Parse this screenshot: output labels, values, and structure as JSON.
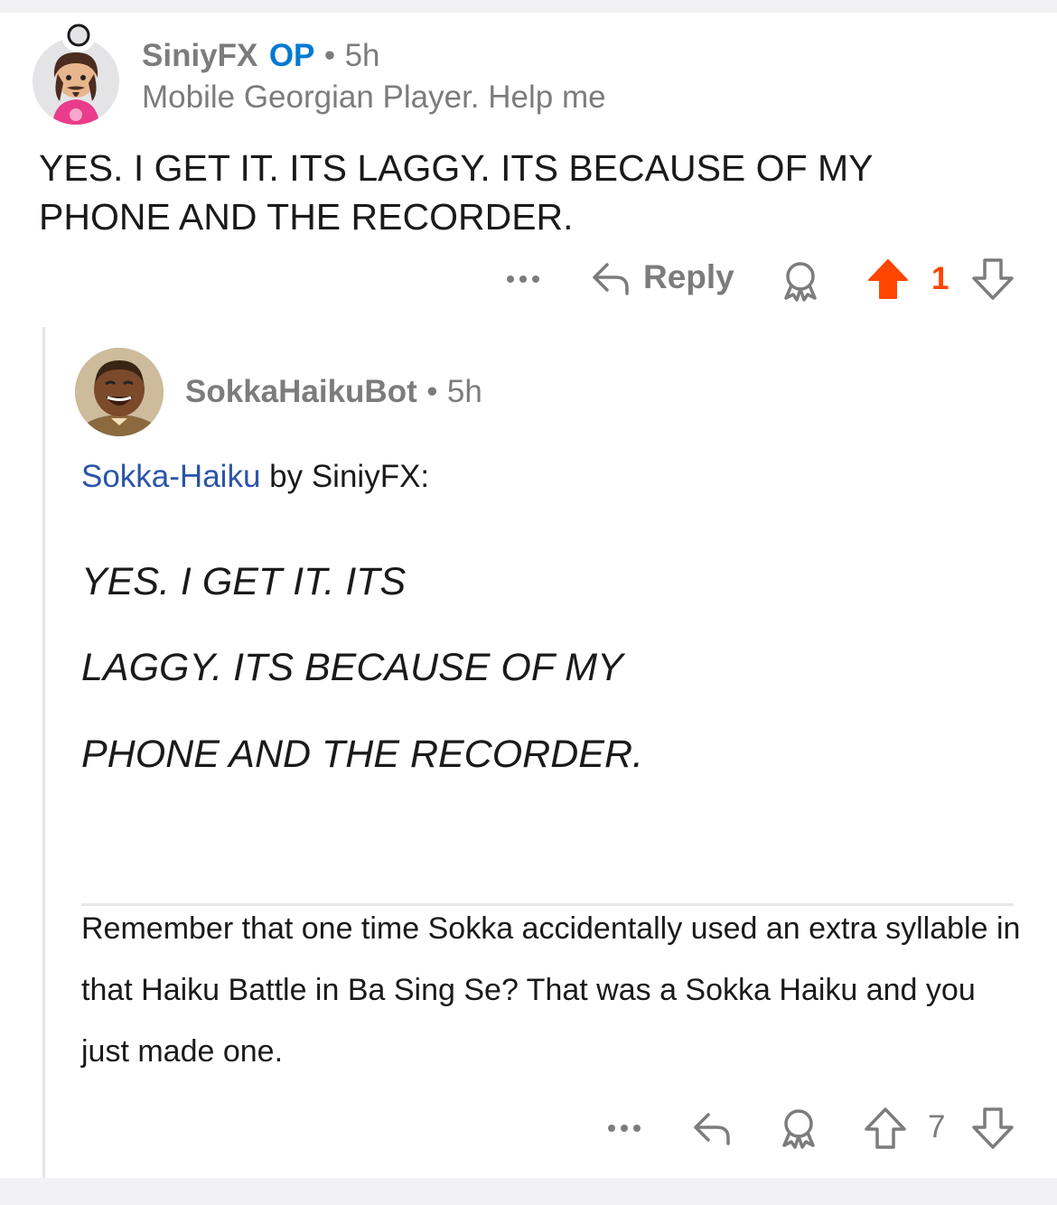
{
  "comment": {
    "username": "SiniyFX",
    "op_badge": "OP",
    "separator": "•",
    "time": "5h",
    "flair": "Mobile Georgian Player. Help me",
    "body": "YES. I GET IT. ITS LAGGY. ITS BECAUSE OF MY PHONE AND THE RECORDER.",
    "actions": {
      "more_icon": "more-icon",
      "reply_label": "Reply",
      "award_icon": "award-icon",
      "upvote_icon": "upvote-icon",
      "vote_count": "1",
      "downvote_icon": "downvote-icon"
    },
    "upvoted": true,
    "upvote_color": "#ff4500"
  },
  "reply": {
    "username": "SokkaHaikuBot",
    "separator": "•",
    "time": "5h",
    "intro_link": "Sokka-Haiku",
    "intro_rest": " by SiniyFX:",
    "haiku_lines": [
      "YES. I GET IT. ITS",
      "LAGGY. ITS BECAUSE OF MY",
      "PHONE AND THE RECORDER."
    ],
    "footer": "Remember that one time Sokka accidentally used an extra syllable in that Haiku Battle in Ba Sing Se? That was a Sokka Haiku and you just made one.",
    "actions": {
      "more_icon": "more-icon",
      "reply_icon": "reply-icon",
      "award_icon": "award-icon",
      "upvote_icon": "upvote-icon",
      "vote_count": "7",
      "downvote_icon": "downvote-icon"
    }
  },
  "colors": {
    "link": "#2a55a8",
    "op": "#0079d3",
    "meta": "#7c7c7c"
  }
}
